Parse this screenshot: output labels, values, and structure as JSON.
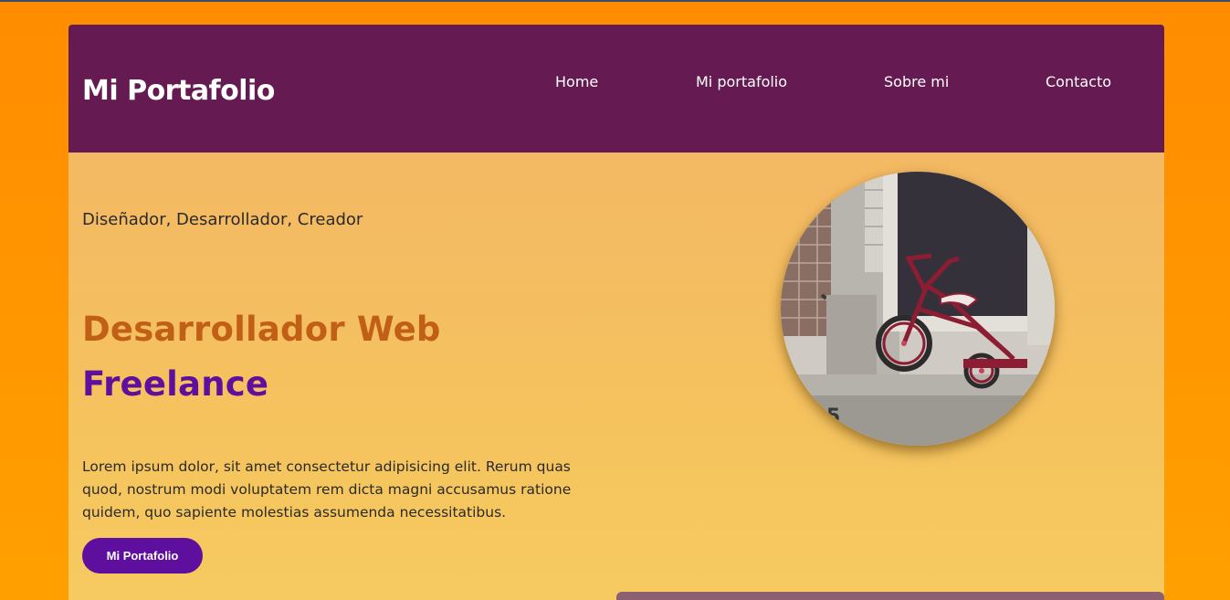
{
  "header": {
    "brand": "Mi Portafolio",
    "nav": [
      "Home",
      "Mi portafolio",
      "Sobre mi",
      "Contacto"
    ]
  },
  "hero": {
    "tagline": "Diseñador, Desarrollador, Creador",
    "title_line1": "Desarrollador Web",
    "title_line2": "Freelance",
    "description": "Lorem ipsum dolor, sit amet consectetur adipisicing elit. Rerum quas quod, nostrum modi voluptatem rem dicta magni accusamus ratione quidem, quo sapiente molestias assumenda necessitatibus.",
    "button_label": "Mi Portafolio",
    "image": "tricycle-photo"
  },
  "colors": {
    "page_background": "#ff8c00",
    "header": "#651b52",
    "title_orange": "#c25f17",
    "title_purple": "#5f0f9e",
    "button": "#5f0f9e"
  }
}
